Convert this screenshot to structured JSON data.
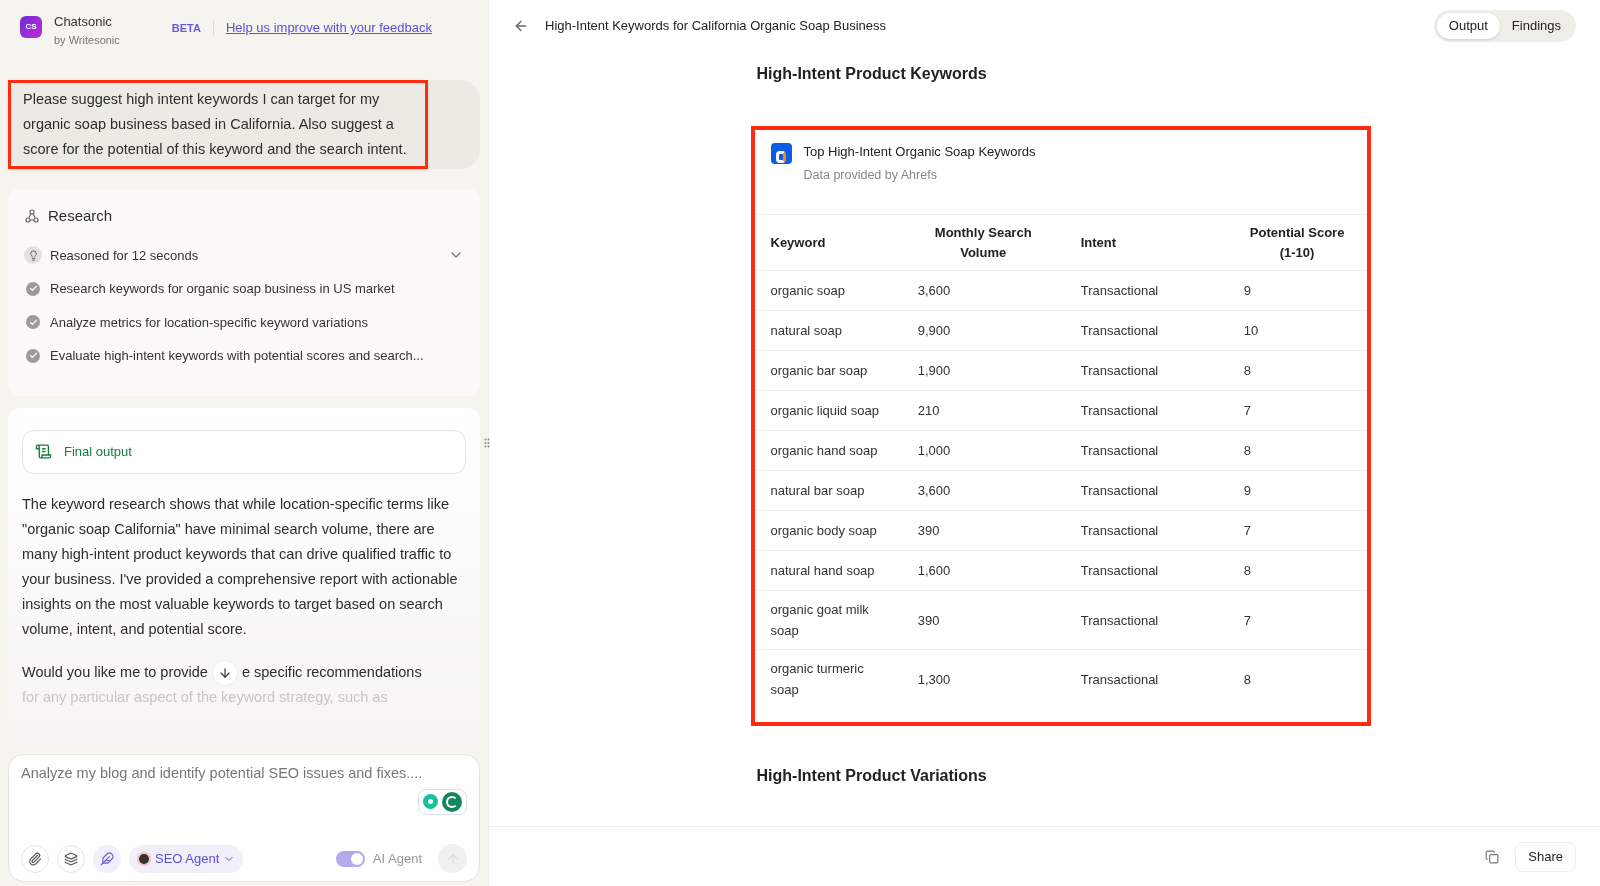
{
  "brand": {
    "name": "Chatsonic",
    "byline": "by Writesonic",
    "logo_text": "CS",
    "badge": "BETA",
    "feedback_link": "Help us improve with your feedback"
  },
  "user_message": {
    "text": "Please suggest high intent keywords I can target for my organic soap business based in California. Also suggest a score for the potential of this keyword and the search intent.",
    "highlighted": true
  },
  "research": {
    "title": "Research",
    "reasoning": {
      "text": "Reasoned for 12 seconds",
      "expanded": false
    },
    "steps": [
      {
        "text": "Research keywords for organic soap business in US market",
        "done": true
      },
      {
        "text": "Analyze metrics for location-specific keyword variations",
        "done": true
      },
      {
        "text": "Evaluate high-intent keywords with potential scores and search...",
        "done": true
      }
    ]
  },
  "final_output": {
    "label": "Final output",
    "paragraph": "The keyword research shows that while location-specific terms like \"organic soap California\" have minimal search volume, there are many high-intent product keywords that can drive qualified traffic to your business. I've provided a comprehensive report with actionable insights on the most valuable keywords to target based on search volume, intent, and potential score.",
    "question_before": "Would you like me to provide",
    "question_after": "e specific recommendations",
    "faded_line": "for any particular aspect of the keyword strategy, such as"
  },
  "composer": {
    "placeholder": "Analyze my blog and identify potential SEO issues and fixes....",
    "agent": "SEO Agent",
    "ai_agent": {
      "label": "AI Agent",
      "on": true
    }
  },
  "document": {
    "title": "High-Intent Keywords for California Organic Soap Business",
    "tabs": [
      {
        "label": "Output",
        "selected": true
      },
      {
        "label": "Findings",
        "selected": false
      }
    ],
    "heading": "High-Intent Product Keywords",
    "table_card": {
      "highlighted": true,
      "title": "Top High-Intent Organic Soap Keywords",
      "source": "Data provided by Ahrefs",
      "columns": [
        "Keyword",
        "Monthly Search Volume",
        "Intent",
        "Potential Score (1-10)"
      ],
      "rows": [
        [
          "organic soap",
          "3,600",
          "Transactional",
          "9"
        ],
        [
          "natural soap",
          "9,900",
          "Transactional",
          "10"
        ],
        [
          "organic bar soap",
          "1,900",
          "Transactional",
          "8"
        ],
        [
          "organic liquid soap",
          "210",
          "Transactional",
          "7"
        ],
        [
          "organic hand soap",
          "1,000",
          "Transactional",
          "8"
        ],
        [
          "natural bar soap",
          "3,600",
          "Transactional",
          "9"
        ],
        [
          "organic body soap",
          "390",
          "Transactional",
          "7"
        ],
        [
          "natural hand soap",
          "1,600",
          "Transactional",
          "8"
        ],
        [
          "organic goat milk soap",
          "390",
          "Transactional",
          "7"
        ],
        [
          "organic turmeric soap",
          "1,300",
          "Transactional",
          "8"
        ]
      ]
    },
    "next_heading": "High-Intent Product Variations",
    "share": "Share"
  }
}
